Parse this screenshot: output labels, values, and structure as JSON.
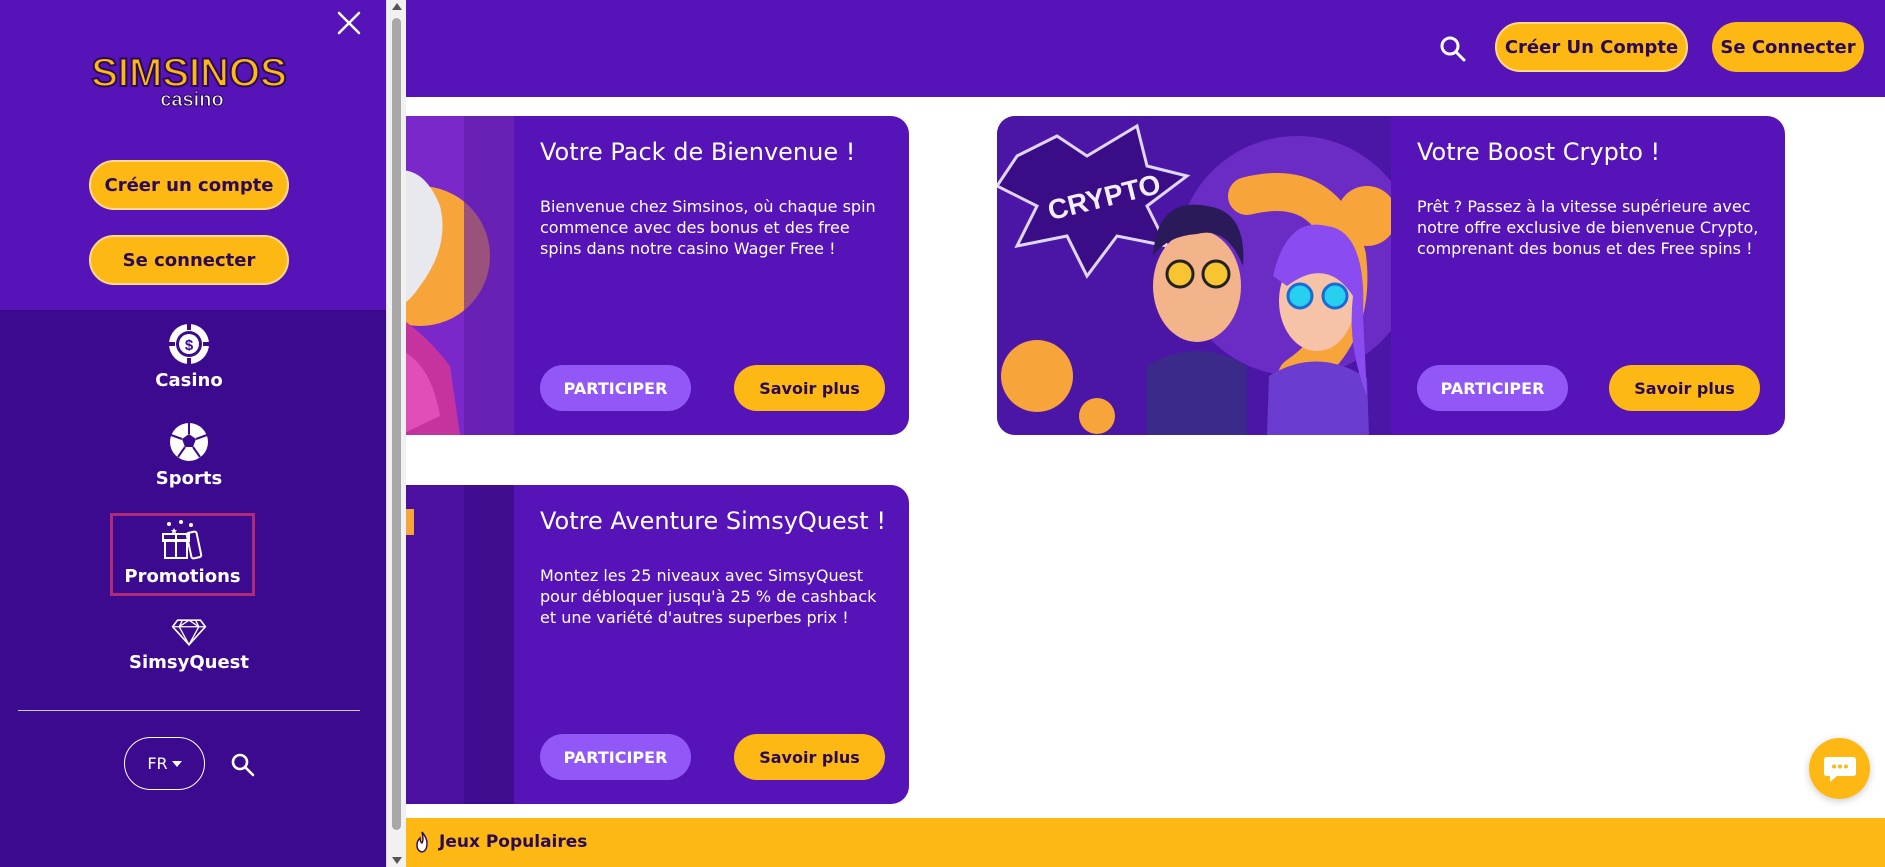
{
  "header": {
    "create_account": "Créer Un Compte",
    "login": "Se Connecter",
    "search_icon": "search-icon"
  },
  "cards": [
    {
      "title": "Votre Pack de Bienvenue !",
      "description": "Bienvenue chez Simsinos, où chaque spin commence avec des bonus et des free spins dans notre casino Wager Free !",
      "participate": "PARTICIPER",
      "learn_more": "Savoir plus"
    },
    {
      "title": "Votre Boost Crypto !",
      "description": "Prêt ? Passez à la vitesse supérieure avec notre offre exclusive de bienvenue Crypto, comprenant des bonus et des Free spins !",
      "participate": "PARTICIPER",
      "learn_more": "Savoir plus",
      "image_text": "CRYPTO"
    },
    {
      "title": "Votre Aventure SimsyQuest !",
      "description": "Montez les 25 niveaux avec SimsyQuest pour débloquer jusqu'à 25 % de cashback et une variété d'autres superbes prix !",
      "participate": "PARTICIPER",
      "learn_more": "Savoir plus"
    }
  ],
  "bottom_bar": {
    "label": "Jeux Populaires",
    "icon": "fire-icon"
  },
  "sidebar": {
    "logo_main": "SIMSINOS",
    "logo_sub": "casino",
    "create_account": "Créer un compte",
    "login": "Se connecter",
    "nav": [
      {
        "label": "Casino",
        "icon": "casino-chip-icon"
      },
      {
        "label": "Sports",
        "icon": "soccer-ball-icon"
      },
      {
        "label": "Promotions",
        "icon": "gift-icon",
        "selected": true
      },
      {
        "label": "SimsyQuest",
        "icon": "diamond-icon"
      }
    ],
    "language": "FR"
  },
  "colors": {
    "primary_purple": "#5613b8",
    "dark_purple": "#3b0a8f",
    "accent_yellow": "#fdb814",
    "button_violet": "#9158f7",
    "highlight_border": "#b02a7a"
  }
}
